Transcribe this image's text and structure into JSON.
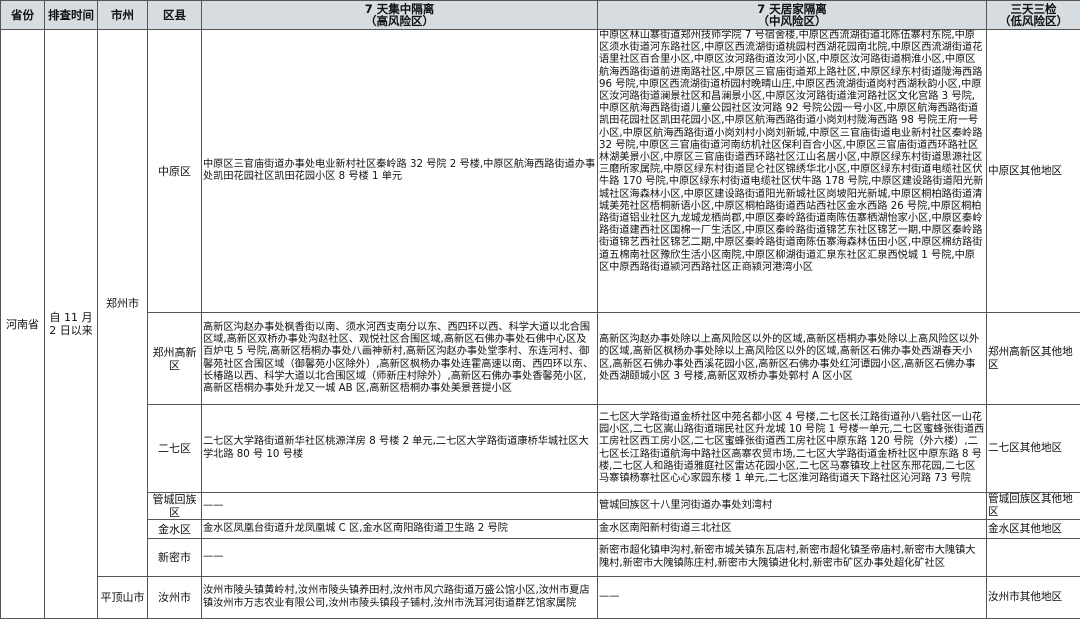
{
  "headers": {
    "province": "省份",
    "time": "排查时间",
    "city": "市州",
    "district": "区县",
    "high_title": "7 天集中隔离",
    "high_sub": "（高风险区）",
    "mid_title": "7 天居家隔离",
    "mid_sub": "（中风险区）",
    "low_title": "三天三检",
    "low_sub": "（低风险区）"
  },
  "province": "河南省",
  "time": "自 11 月 2 日以来",
  "cities": {
    "zhengzhou": "郑州市",
    "pingdingshan": "平顶山市"
  },
  "rows": [
    {
      "district": "中原区",
      "high": "中原区三官庙街道办事处电业新村社区秦岭路 32 号院 2 号楼,中原区航海西路街道办事处凯田花园社区凯田花园小区 8 号楼 1 单元",
      "mid": "中原区林山寨街道郑州技师学院 7 号宿舍楼,中原区西流湖街道北陈伍寨村东院,中原区须水街道河东路社区,中原区西流湖街道桃园村西湖花园南北院,中原区西流湖街道花语里社区百合里小区,中原区汝河路街道汝河小区,中原区汝河路街道桐淮小区,中原区航海西路街道前进南路社区,中原区三官庙街道郑上路社区,中原区绿东村街道陇海西路 96 号院,中原区西流湖街道桥园村晚晴山庄,中原区西流湖街道岗村西湖秋韵小区,中原区汝河路街道澜景社区和昌澜景小区,中原区汝河路街道淮河路社区文化宫路 3 号院,中原区航海西路街道儿童公园社区汝河路 92 号院公园一号小区,中原区航海西路街道凯田花园社区凯田花园小区,中原区航海西路街道小岗刘村陇海西路 98 号院王府一号小区,中原区航海西路街道小岗刘村小岗刘新城,中原区三官庙街道电业新村社区秦岭路 32 号院,中原区三官庙街道河南纺机社区保利百合小区,中原区三官庙街道西环路社区林湖美景小区,中原区三官庙街道西环路社区江山名居小区,中原区绿东村街道思源社区三磨所家属院,中原区绿东村街道昆仑社区锦绣华北小区,中原区绿东村街道电缆社区伏牛路 170 号院,中原区绿东村街道电缆社区伏牛路 178 号院,中原区建设路街道阳光新城社区海森林小区,中原区建设路街道阳光新城社区岗坡阳光新城,中原区桐柏路街道清城美苑社区梧桐新语小区,中原区桐柏路街道西站西社区金水西路 26 号院,中原区桐柏路街道铝业社区九龙城龙栖尚郡,中原区秦岭路街道南陈伍寨栖湖怡家小区,中原区秦岭路街道建西社区国棉一厂生活区,中原区秦岭路街道锦艺东社区锦艺一期,中原区秦岭路街道锦艺西社区锦艺二期,中原区秦岭路街道南陈伍寨海森林伍田小区,中原区棉纺路街道五棉南社区豫欣生活小区南院,中原区柳湖街道汇泉东社区汇泉西悦城 1 号院,中原区中原西路街道颍河西路社区正商颍河港湾小区",
      "low": "中原区其他地区"
    },
    {
      "district": "郑州高新区",
      "high": "高新区沟赵办事处枫香街以南、须水河西支南分以东、西四环以西、科学大道以北合围区域,高新区双桥办事处沟赵社区、观悦社区合围区域,高新区石佛办事处石佛中心区及百炉屯 5 号院,高新区梧桐办事处八画神新村,高新区沟赵办事处堂李村、东连河村、御馨苑社区合围区域（御馨苑小区除外）,高新区枫杨办事处连霍高速以南、西四环以东、长椿路以西、科学大道以北合围区域（师新庄村除外）,高新区石佛办事处香馨苑小区,高新区梧桐办事处升龙又一城 AB 区,高新区梧桐办事处美景菩提小区",
      "mid": "高新区沟赵办事处除以上高风险区以外的区域,高新区梧桐办事处除以上高风险区以外的区域,高新区枫杨办事处除以上高风险区以外的区域,高新区石佛办事处西湖春天小区,高新区石佛办事处西溪花园小区,高新区石佛办事处红河谭园小区,高新区石佛办事处西湖颐城小区 3 号楼,高新区双桥办事处郭村 A 区小区",
      "low": "郑州高新区其他地区"
    },
    {
      "district": "二七区",
      "high": "二七区大学路街道新华社区桃源洋房 8 号楼 2 单元,二七区大学路街道康桥华城社区大学北路 80 号 10 号楼",
      "mid": "二七区大学路街道金桥社区中苑名都小区 4 号楼,二七区长江路街道孙八砦社区一山花园小区,二七区嵩山路街道瑞民社区升龙城 10 号院 1 号楼一单元,二七区蜜蜂张街道西工房社区西工房小区,二七区蜜蜂张街道西工房社区中原东路 120 号院（外六楼）,二七区长江路街道航海中路社区高寨农贸市场,二七区大学路街道金桥社区中原东路 8 号楼,二七区人和路街道雅庭社区雷达花园小区,二七区马寨镇玫上社区东邢花园,二七区马寨镇杨寨社区心心家园东楼 1 单元,二七区淮河路街道天下路社区沁河路 73 号院",
      "low": "二七区其他地区"
    },
    {
      "district": "管城回族区",
      "high": "——",
      "mid": "管城回族区十八里河街道办事处刘湾村",
      "low": "管城回族区其他地区"
    },
    {
      "district": "金水区",
      "high": "金水区凤凰台街道升龙凤凰城 C 区,金水区南阳路街道卫生路 2 号院",
      "mid": "金水区南阳新村街道三北社区",
      "low": "金水区其他地区"
    },
    {
      "district": "新密市",
      "high": "——",
      "mid": "新密市超化镇申沟村,新密市城关镇东瓦店村,新密市超化镇圣帝庙村,新密市大隗镇大隗村,新密市大隗镇陈庄村,新密市大隗镇进化村,新密市矿区办事处超化矿社区",
      "low": ""
    },
    {
      "district": "汝州市",
      "high": "汝州市陵头镇黄岭村,汝州市陵头镇养田村,汝州市风穴路街道万盛公馆小区,汝州市夏店镇汝州市万志农业有限公司,汝州市陵头镇段子铺村,汝州市洗耳河街道群艺馆家属院",
      "mid": "——",
      "low": "汝州市其他地区"
    }
  ]
}
